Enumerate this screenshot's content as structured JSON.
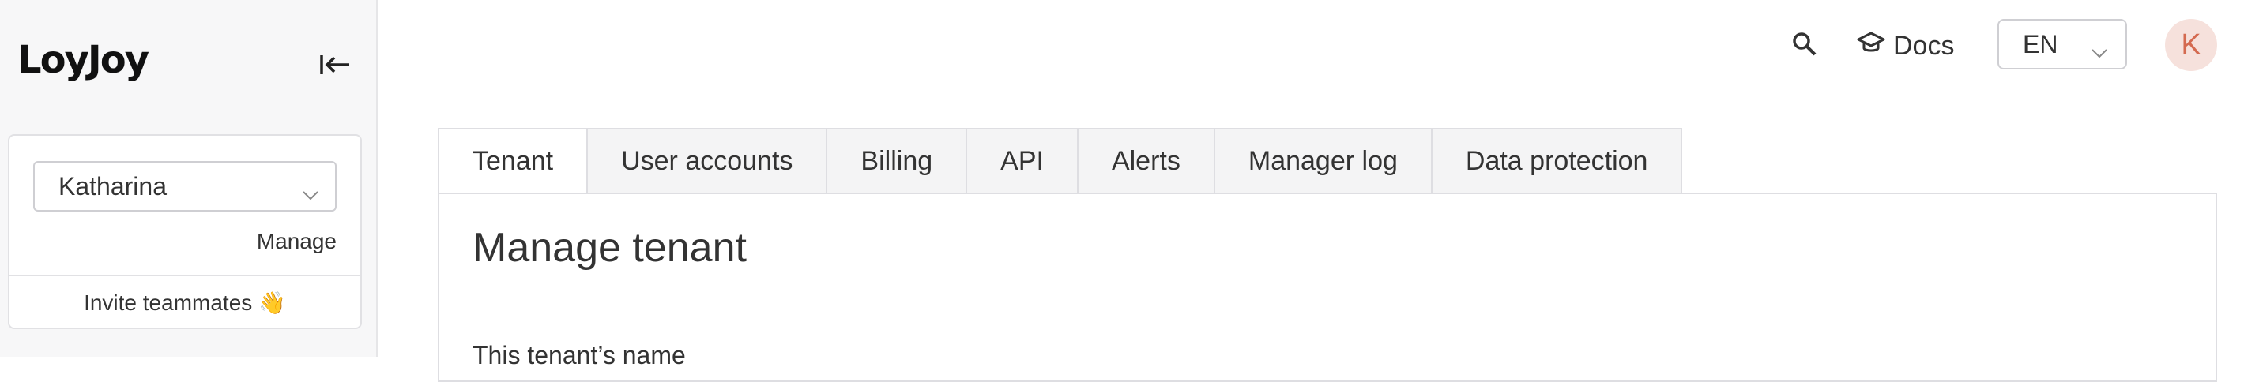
{
  "app": {
    "logo": "LoyJoy"
  },
  "sidebar": {
    "team_select_value": "Katharina",
    "manage_label": "Manage",
    "invite_label": "Invite teammates 👋"
  },
  "topbar": {
    "docs_label": "Docs",
    "language": "EN",
    "avatar_initial": "K",
    "avatar_color": "#d46a50"
  },
  "tabs": [
    "Tenant",
    "User accounts",
    "Billing",
    "API",
    "Alerts",
    "Manager log",
    "Data protection"
  ],
  "active_tab": "Tenant",
  "main": {
    "title": "Manage tenant",
    "field_label": "This tenant’s name"
  },
  "icons": [
    "sidebar-collapse-icon",
    "chevron-down-icon",
    "search-icon",
    "graduation-cap-icon"
  ]
}
